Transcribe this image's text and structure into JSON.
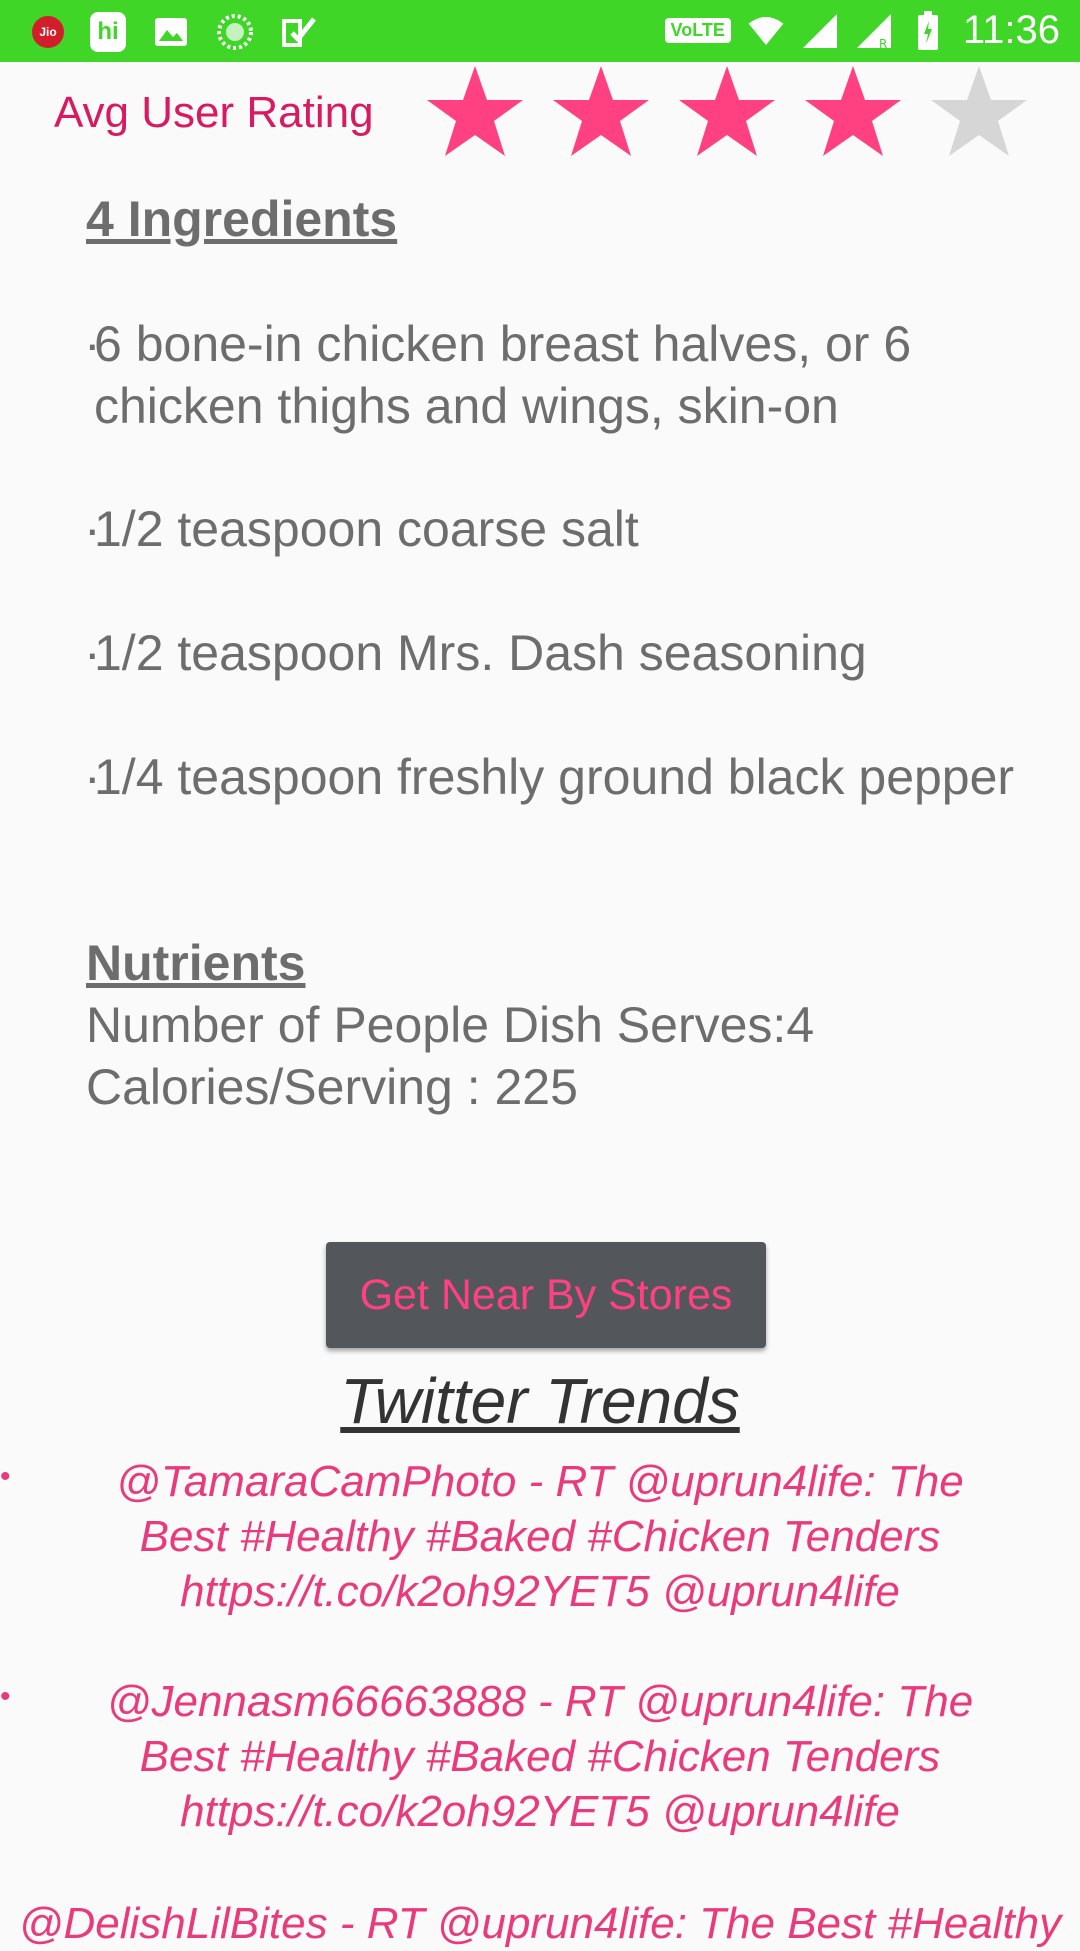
{
  "status_bar": {
    "time": "11:36",
    "volte": "VoLTE",
    "hi_app": "hi",
    "jio": "Jio",
    "left_icons": [
      "jio-icon",
      "hi-icon",
      "gallery-icon",
      "loading-icon",
      "check-icon"
    ],
    "right_icons": [
      "volte-icon",
      "wifi-icon",
      "signal-icon",
      "signal-roaming-icon",
      "battery-icon"
    ],
    "color": "#3fd628"
  },
  "rating": {
    "label": "Avg User Rating",
    "value": 4,
    "max": 5,
    "star_color": "#ff4081",
    "empty_color": "#d6d6d6"
  },
  "ingredients": {
    "heading": "4 Ingredients",
    "bullet": "·",
    "items": [
      {
        "line1": "6 bone-in chicken breast halves, or 6",
        "line2": "chicken thighs and wings, skin-on"
      },
      {
        "line1": "1/2 teaspoon coarse salt"
      },
      {
        "line1": "1/2 teaspoon Mrs. Dash seasoning"
      },
      {
        "line1": "1/4 teaspoon freshly ground black pepper"
      }
    ]
  },
  "nutrients": {
    "heading": "Nutrients",
    "serves": "Number of People Dish Serves:4",
    "calories": "Calories/Serving : 225"
  },
  "store_button": {
    "label": "Get Near By Stores"
  },
  "twitter": {
    "title": "Twitter Trends",
    "bullet": "•",
    "tweets": [
      {
        "l1": "@TamaraCamPhoto - RT @uprun4life: The",
        "l2": "Best #Healthy #Baked #Chicken Tenders",
        "l3": "https://t.co/k2oh92YET5 @uprun4life"
      },
      {
        "l1": "@Jennasm66663888 - RT @uprun4life: The",
        "l2": "Best #Healthy #Baked #Chicken Tenders",
        "l3": "https://t.co/k2oh92YET5 @uprun4life"
      },
      {
        "l1": "@DelishLilBites - RT @uprun4life: The Best #Healthy"
      }
    ]
  }
}
